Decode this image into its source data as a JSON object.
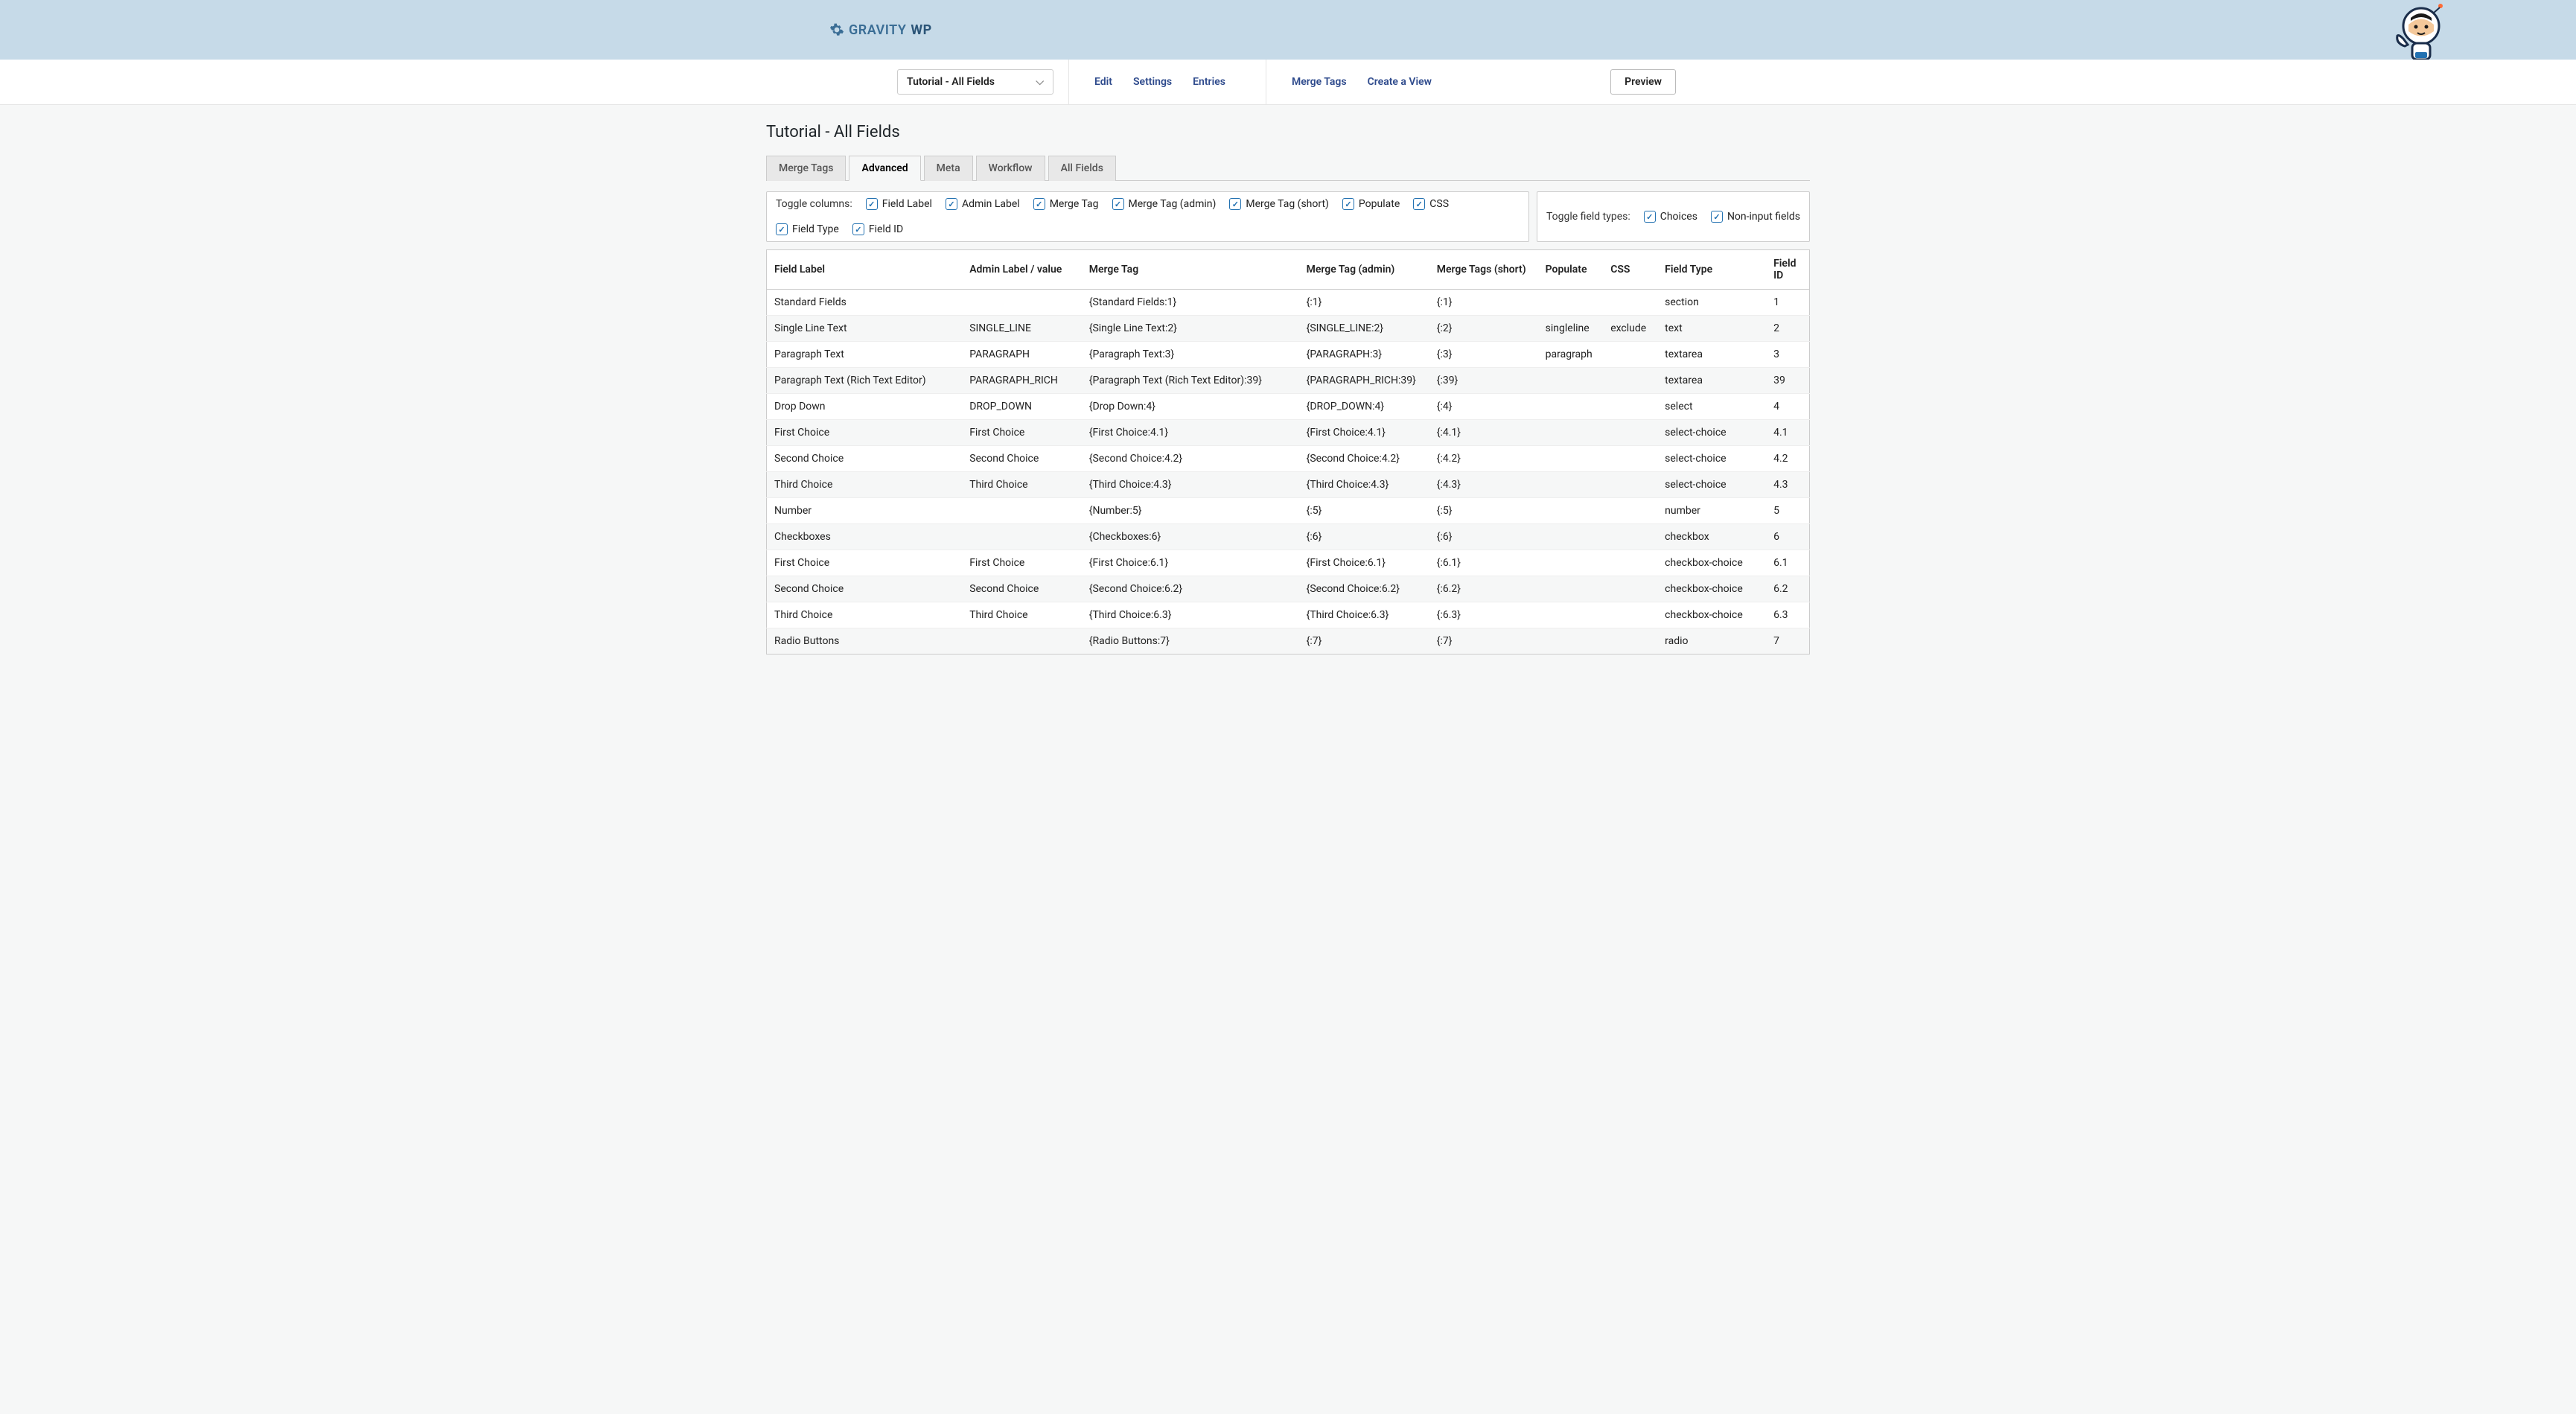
{
  "brand": {
    "name_light": "GRAVITY",
    "name_bold": "WP"
  },
  "form_selector": "Tutorial - All Fields",
  "nav": {
    "edit": "Edit",
    "settings": "Settings",
    "entries": "Entries",
    "merge_tags": "Merge Tags",
    "create_view": "Create a View"
  },
  "preview_label": "Preview",
  "page_title": "Tutorial - All Fields",
  "tabs": {
    "merge_tags": "Merge Tags",
    "advanced": "Advanced",
    "meta": "Meta",
    "workflow": "Workflow",
    "all_fields": "All Fields"
  },
  "toggle_columns_label": "Toggle columns:",
  "toggle_columns": {
    "field_label": "Field Label",
    "admin_label": "Admin Label",
    "merge_tag": "Merge Tag",
    "merge_tag_admin": "Merge Tag (admin)",
    "merge_tag_short": "Merge Tag (short)",
    "populate": "Populate",
    "css": "CSS",
    "field_type": "Field Type",
    "field_id": "Field ID"
  },
  "toggle_types_label": "Toggle field types:",
  "toggle_types": {
    "choices": "Choices",
    "non_input": "Non-input fields"
  },
  "columns": {
    "field_label": "Field Label",
    "admin_label": "Admin Label / value",
    "merge_tag": "Merge Tag",
    "merge_tag_admin": "Merge Tag (admin)",
    "merge_tags_short": "Merge Tags (short)",
    "populate": "Populate",
    "css": "CSS",
    "field_type": "Field Type",
    "field_id": "Field ID"
  },
  "rows": [
    {
      "field_label": "Standard Fields",
      "admin": "",
      "mt": "{Standard Fields:1}",
      "mta": "{:1}",
      "mts": "{:1}",
      "pop": "",
      "css": "",
      "ftype": "section",
      "fid": "1"
    },
    {
      "field_label": "Single Line Text",
      "admin": "SINGLE_LINE",
      "mt": "{Single Line Text:2}",
      "mta": "{SINGLE_LINE:2}",
      "mts": "{:2}",
      "pop": "singleline",
      "css": "exclude",
      "ftype": "text",
      "fid": "2"
    },
    {
      "field_label": "Paragraph Text",
      "admin": "PARAGRAPH",
      "mt": "{Paragraph Text:3}",
      "mta": "{PARAGRAPH:3}",
      "mts": "{:3}",
      "pop": "paragraph",
      "css": "",
      "ftype": "textarea",
      "fid": "3"
    },
    {
      "field_label": "Paragraph Text (Rich Text Editor)",
      "admin": "PARAGRAPH_RICH",
      "mt": "{Paragraph Text (Rich Text Editor):39}",
      "mta": "{PARAGRAPH_RICH:39}",
      "mts": "{:39}",
      "pop": "",
      "css": "",
      "ftype": "textarea",
      "fid": "39"
    },
    {
      "field_label": "Drop Down",
      "admin": "DROP_DOWN",
      "mt": "{Drop Down:4}",
      "mta": "{DROP_DOWN:4}",
      "mts": "{:4}",
      "pop": "",
      "css": "",
      "ftype": "select",
      "fid": "4"
    },
    {
      "field_label": "First Choice",
      "admin": "First Choice",
      "mt": "{First Choice:4.1}",
      "mta": "{First Choice:4.1}",
      "mts": "{:4.1}",
      "pop": "",
      "css": "",
      "ftype": "select-choice",
      "fid": "4.1"
    },
    {
      "field_label": "Second Choice",
      "admin": "Second Choice",
      "mt": "{Second Choice:4.2}",
      "mta": "{Second Choice:4.2}",
      "mts": "{:4.2}",
      "pop": "",
      "css": "",
      "ftype": "select-choice",
      "fid": "4.2"
    },
    {
      "field_label": "Third Choice",
      "admin": "Third Choice",
      "mt": "{Third Choice:4.3}",
      "mta": "{Third Choice:4.3}",
      "mts": "{:4.3}",
      "pop": "",
      "css": "",
      "ftype": "select-choice",
      "fid": "4.3"
    },
    {
      "field_label": "Number",
      "admin": "",
      "mt": "{Number:5}",
      "mta": "{:5}",
      "mts": "{:5}",
      "pop": "",
      "css": "",
      "ftype": "number",
      "fid": "5"
    },
    {
      "field_label": "Checkboxes",
      "admin": "",
      "mt": "{Checkboxes:6}",
      "mta": "{:6}",
      "mts": "{:6}",
      "pop": "",
      "css": "",
      "ftype": "checkbox",
      "fid": "6"
    },
    {
      "field_label": "First Choice",
      "admin": "First Choice",
      "mt": "{First Choice:6.1}",
      "mta": "{First Choice:6.1}",
      "mts": "{:6.1}",
      "pop": "",
      "css": "",
      "ftype": "checkbox-choice",
      "fid": "6.1"
    },
    {
      "field_label": "Second Choice",
      "admin": "Second Choice",
      "mt": "{Second Choice:6.2}",
      "mta": "{Second Choice:6.2}",
      "mts": "{:6.2}",
      "pop": "",
      "css": "",
      "ftype": "checkbox-choice",
      "fid": "6.2"
    },
    {
      "field_label": "Third Choice",
      "admin": "Third Choice",
      "mt": "{Third Choice:6.3}",
      "mta": "{Third Choice:6.3}",
      "mts": "{:6.3}",
      "pop": "",
      "css": "",
      "ftype": "checkbox-choice",
      "fid": "6.3"
    },
    {
      "field_label": "Radio Buttons",
      "admin": "",
      "mt": "{Radio Buttons:7}",
      "mta": "{:7}",
      "mts": "{:7}",
      "pop": "",
      "css": "",
      "ftype": "radio",
      "fid": "7"
    }
  ]
}
